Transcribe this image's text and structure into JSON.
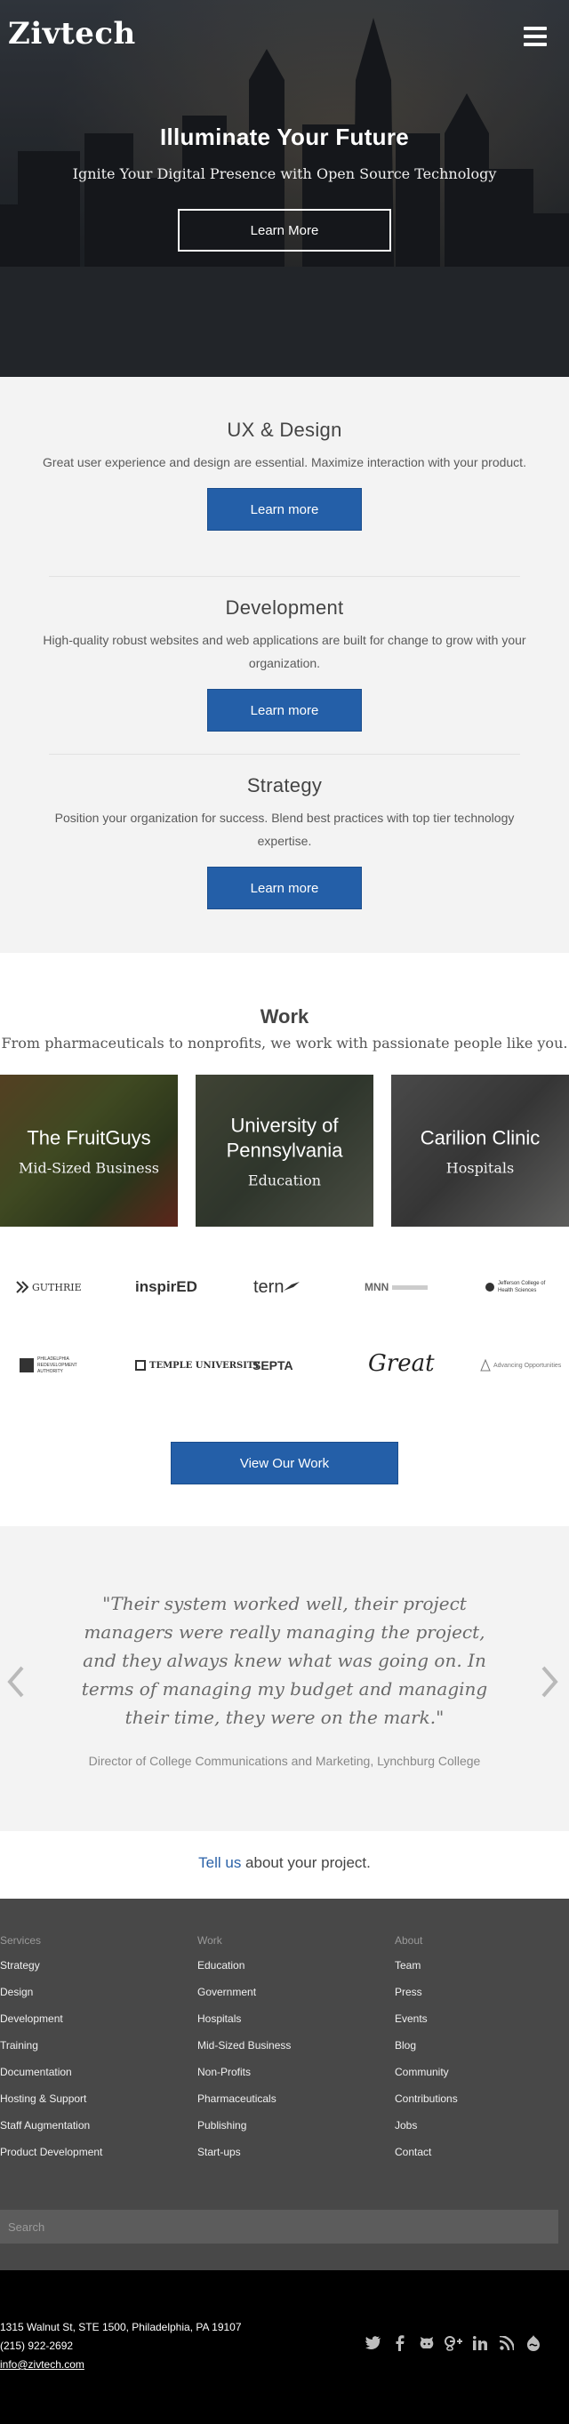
{
  "header": {
    "logo": "Zivtech",
    "menu_icon": "hamburger-menu-icon"
  },
  "hero": {
    "title": "Illuminate Your Future",
    "subtitle": "Ignite Your Digital Presence with Open Source Technology",
    "button": "Learn More"
  },
  "services": [
    {
      "title": "UX & Design",
      "text": "Great user experience and design are essential. Maximize interaction with your product.",
      "button": "Learn more"
    },
    {
      "title": "Development",
      "text": "High-quality robust websites and web applications are built for change to grow with your organization.",
      "button": "Learn more"
    },
    {
      "title": "Strategy",
      "text": "Position your organization for success. Blend best practices with top tier technology expertise.",
      "button": "Learn more"
    }
  ],
  "work": {
    "title": "Work",
    "subtitle": "From pharmaceuticals to nonprofits, we work with passionate people like you.",
    "tiles": [
      {
        "title": "The FruitGuys",
        "category": "Mid-Sized Business"
      },
      {
        "title": "University of Pennsylvania",
        "category": "Education"
      },
      {
        "title": "Carilion Clinic",
        "category": "Hospitals"
      }
    ],
    "clients": [
      "GUTHRIE",
      "inspirED",
      "tern",
      "MNN",
      "Jefferson College of Health Sciences",
      "PHILADELPHIA REDEVELOPMENT AUTHORITY",
      "TEMPLE UNIVERSITY",
      "SEPTA",
      "Great",
      "Advancing Opportunities"
    ],
    "view_button": "View Our Work"
  },
  "testimonial": {
    "quote": "\"Their system worked well, their project managers were really managing the project, and they always knew what was going on. In terms of managing my budget and managing their time, they were on the mark.\"",
    "attribution": "Director of College Communications and Marketing, Lynchburg College"
  },
  "cta": {
    "link": "Tell us",
    "rest": " about your project."
  },
  "footer": {
    "columns": [
      {
        "heading": "Services",
        "items": [
          "Strategy",
          "Design",
          "Development",
          "Training",
          "Documentation",
          "Hosting & Support",
          "Staff Augmentation",
          "Product Development"
        ]
      },
      {
        "heading": "Work",
        "items": [
          "Education",
          "Government",
          "Hospitals",
          "Mid-Sized Business",
          "Non-Profits",
          "Pharmaceuticals",
          "Publishing",
          "Start-ups"
        ]
      },
      {
        "heading": "About",
        "items": [
          "Team",
          "Press",
          "Events",
          "Blog",
          "Community",
          "Contributions",
          "Jobs",
          "Contact"
        ]
      }
    ],
    "search_placeholder": "Search"
  },
  "contact": {
    "address": "1315 Walnut St, STE 1500, Philadelphia, PA 19107",
    "phone": "(215) 922-2692",
    "email": "info@zivtech.com"
  },
  "social_icons": [
    "twitter-icon",
    "facebook-icon",
    "github-icon",
    "google-plus-icon",
    "linkedin-icon",
    "rss-icon",
    "drupal-icon"
  ],
  "colors": {
    "accent": "#245fa8",
    "link": "#2b62a8",
    "footer": "#484848",
    "bottom": "#000000",
    "section_bg": "#f3f3f3"
  }
}
